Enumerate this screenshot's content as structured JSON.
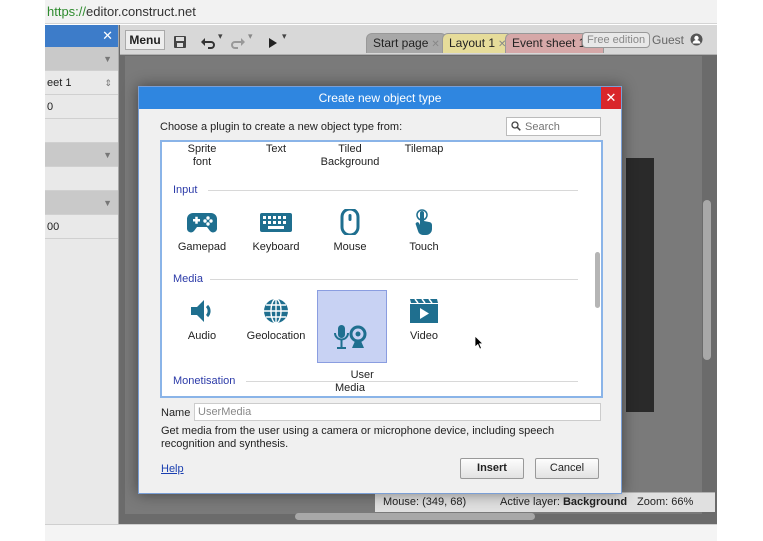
{
  "browser": {
    "url_scheme": "https://",
    "url_host": "editor.construct.net"
  },
  "left_panel": {
    "rows": [
      {
        "text": "",
        "type": "section",
        "arrow": "▼"
      },
      {
        "text": "eet 1",
        "type": "row",
        "arrow": "⇕"
      },
      {
        "text": "0",
        "type": "row",
        "arrow": ""
      },
      {
        "text": "",
        "type": "row",
        "arrow": ""
      },
      {
        "text": "",
        "type": "section",
        "arrow": "▼"
      },
      {
        "text": "",
        "type": "row",
        "arrow": ""
      },
      {
        "text": "",
        "type": "section",
        "arrow": "▼"
      },
      {
        "text": "00",
        "type": "row",
        "arrow": ""
      }
    ]
  },
  "toolbar": {
    "menu_label": "Menu",
    "tabs": [
      {
        "label": "Start page",
        "color": "#a8a8a8"
      },
      {
        "label": "Layout 1",
        "color": "#e6dc9a"
      },
      {
        "label": "Event sheet 1",
        "color": "#d6a8a8"
      }
    ],
    "free_edition": "Free edition",
    "guest": "Guest"
  },
  "status": {
    "mouse": "Mouse: (349, 68)",
    "layer_label": "Active layer: ",
    "layer_value": "Background",
    "zoom": "Zoom: 66%"
  },
  "dialog": {
    "title": "Create new object type",
    "prompt": "Choose a plugin to create a new object type from:",
    "search_placeholder": "Search",
    "top_row": [
      "Sprite\nfont",
      "Text",
      "Tiled\nBackground",
      "Tilemap"
    ],
    "categories": [
      {
        "name": "Input",
        "plugins": [
          {
            "label": "Gamepad",
            "icon": "gamepad-icon"
          },
          {
            "label": "Keyboard",
            "icon": "keyboard-icon"
          },
          {
            "label": "Mouse",
            "icon": "mouse-icon"
          },
          {
            "label": "Touch",
            "icon": "touch-icon"
          }
        ]
      },
      {
        "name": "Media",
        "plugins": [
          {
            "label": "Audio",
            "icon": "audio-icon"
          },
          {
            "label": "Geolocation",
            "icon": "globe-icon"
          },
          {
            "label": "User\nMedia",
            "icon": "user-media-icon",
            "selected": true
          },
          {
            "label": "Video",
            "icon": "video-icon"
          }
        ]
      },
      {
        "name": "Monetisation",
        "plugins": []
      }
    ],
    "name_label": "Name",
    "name_value": "UserMedia",
    "description": "Get media from the user using a camera or microphone device, including speech recognition and synthesis.",
    "help_label": "Help",
    "insert_label": "Insert",
    "cancel_label": "Cancel",
    "icon_color": "#1f6f8f"
  }
}
